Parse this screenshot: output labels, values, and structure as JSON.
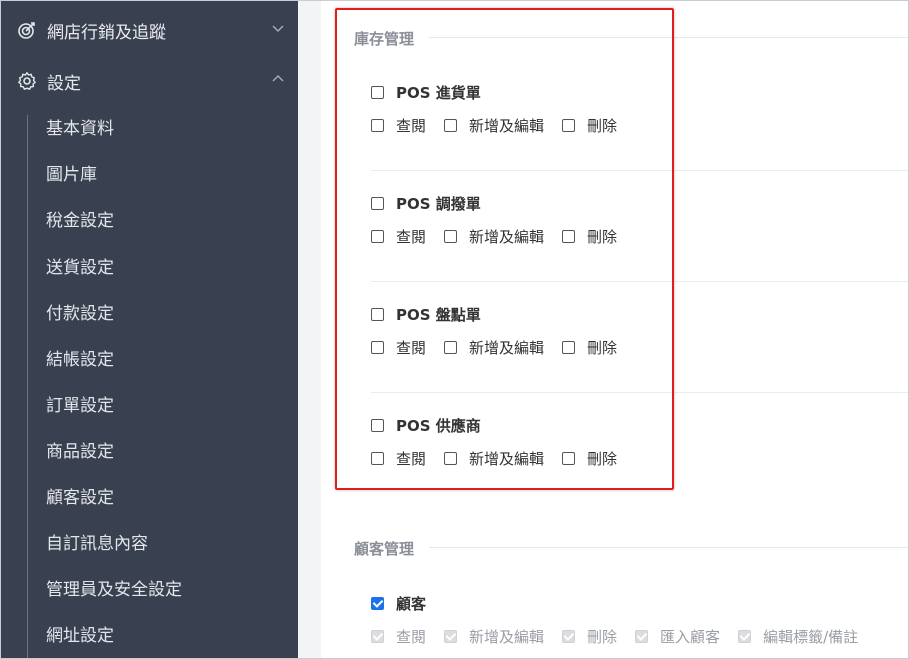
{
  "sidebar": {
    "marketing": {
      "label": "網店行銷及追蹤",
      "icon": "target-icon"
    },
    "settings": {
      "label": "設定",
      "icon": "gear-icon"
    },
    "items": [
      {
        "label": "基本資料"
      },
      {
        "label": "圖片庫"
      },
      {
        "label": "稅金設定"
      },
      {
        "label": "送貨設定"
      },
      {
        "label": "付款設定"
      },
      {
        "label": "結帳設定"
      },
      {
        "label": "訂單設定"
      },
      {
        "label": "商品設定"
      },
      {
        "label": "顧客設定"
      },
      {
        "label": "自訂訊息內容"
      },
      {
        "label": "管理員及安全設定"
      },
      {
        "label": "網址設定"
      }
    ]
  },
  "inventory": {
    "title": "庫存管理",
    "groups": [
      {
        "name": "POS 進貨單",
        "options": [
          "查閱",
          "新增及編輯",
          "刪除"
        ]
      },
      {
        "name": "POS 調撥單",
        "options": [
          "查閱",
          "新增及編輯",
          "刪除"
        ]
      },
      {
        "name": "POS 盤點單",
        "options": [
          "查閱",
          "新增及編輯",
          "刪除"
        ]
      },
      {
        "name": "POS 供應商",
        "options": [
          "查閱",
          "新增及編輯",
          "刪除"
        ]
      }
    ]
  },
  "customers": {
    "title": "顧客管理",
    "group": {
      "name": "顧客",
      "checked": true,
      "options": [
        "查閱",
        "新增及編輯",
        "刪除",
        "匯入顧客",
        "編輯標籤/備註"
      ]
    }
  },
  "colors": {
    "sidebar": "#394050",
    "accent": "#1a73e8",
    "highlight": "#e31c1c"
  }
}
